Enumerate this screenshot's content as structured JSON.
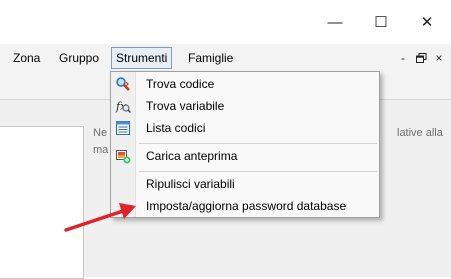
{
  "menubar": {
    "items": [
      "Zona",
      "Gruppo",
      "Strumenti",
      "Famiglie"
    ]
  },
  "window_controls": {
    "minimize": "—",
    "maximize": "☐",
    "close": "✕"
  },
  "mdi_controls": {
    "minimize": "-",
    "restore": "🗗",
    "close": "×"
  },
  "strumenti_menu": {
    "items": [
      {
        "label": "Trova codice",
        "icon": "find-code-icon"
      },
      {
        "label": "Trova variabile",
        "icon": "find-variable-icon"
      },
      {
        "label": "Lista codici",
        "icon": "list-icon"
      },
      {
        "label": "Carica anteprima",
        "icon": "preview-icon"
      },
      {
        "label": "Ripulisci variabili",
        "icon": ""
      },
      {
        "label": "Imposta/aggiorna password database",
        "icon": ""
      }
    ]
  },
  "background": {
    "text_left_top": "Ne",
    "text_left_bottom": "ma",
    "text_right": "lative alla"
  },
  "colors": {
    "arrow": "#e0232b",
    "menu_highlight": "#e8eef6"
  }
}
